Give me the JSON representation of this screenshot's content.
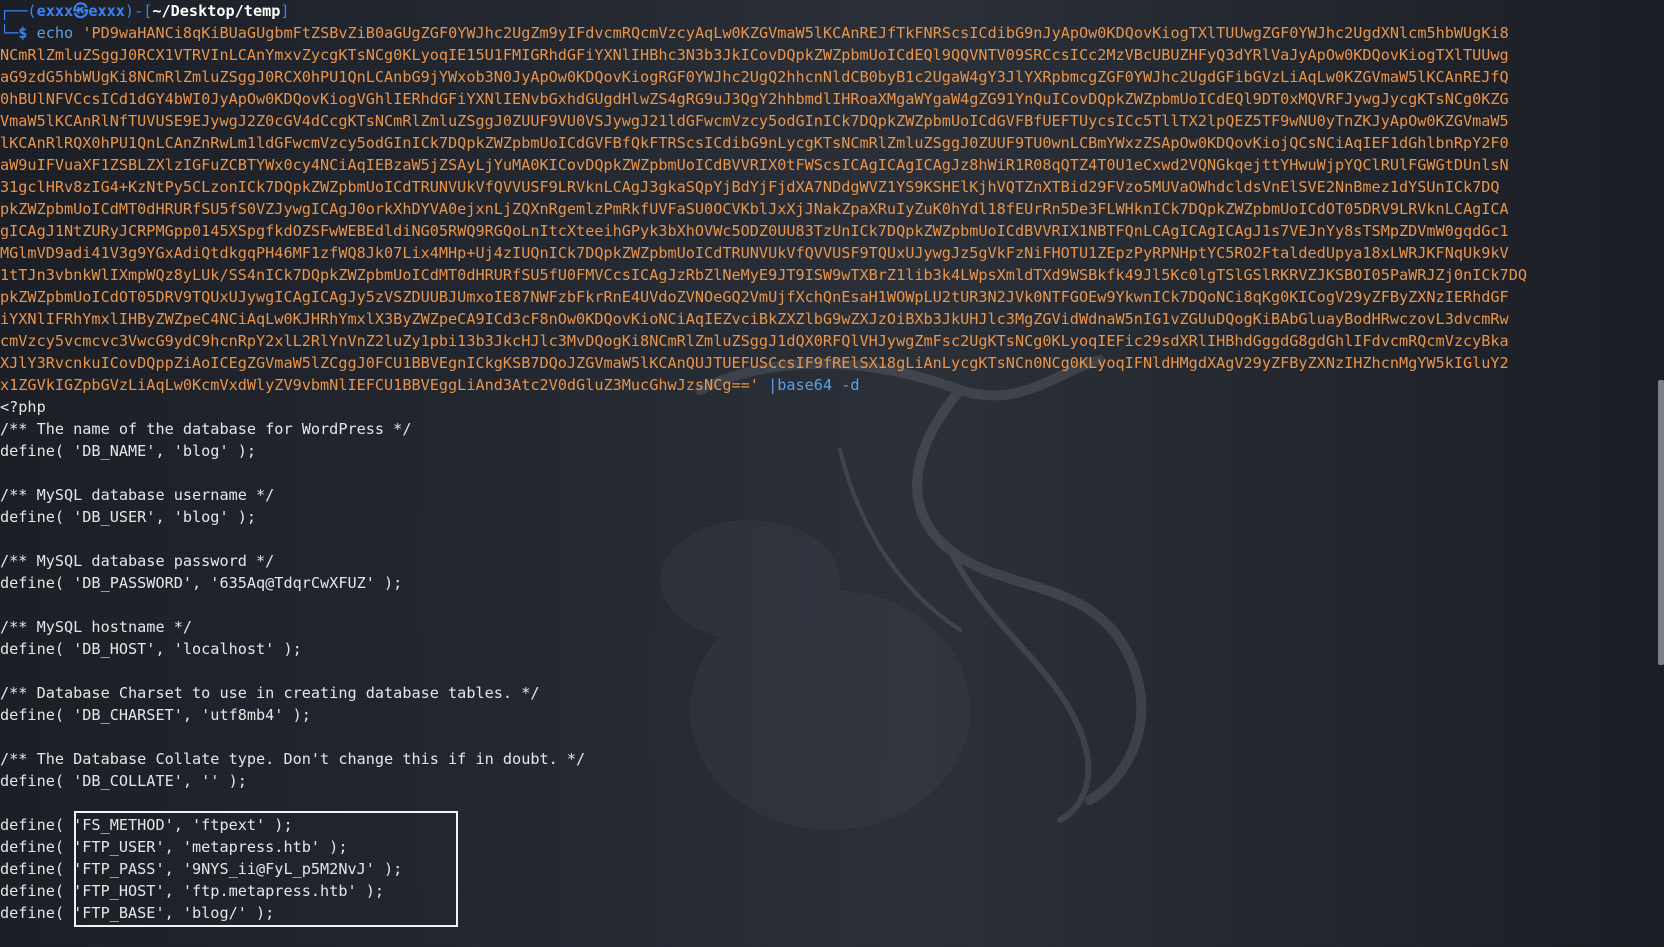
{
  "prompt": {
    "user": "exxx㉿exxx",
    "path": "~/Desktop/temp",
    "symbol": "$"
  },
  "command": {
    "name": "echo",
    "base64_lines": [
      "'PD9waHANCi8qKiBUaGUgbmFtZSBvZiB0aGUgZGF0YWJhc2UgZm9yIFdvcmRQcmVzcyAqLw0KZGVmaW5lKCAnREJfTkFNRScsICdibG9nJyApOw0KDQovKiogTXlTUUwgZGF0YWJhc2UgdXNlcm5hbWUgKi8",
      "NCmRlZmluZSggJ0RCX1VTRVInLCAnYmxvZycgKTsNCg0KLyoqIE15U1FMIGRhdGFiYXNlIHBhc3N3b3JkICovDQpkZWZpbmUoICdEQl9QQVNTV09SRCcsICc2MzVBcUBUZHFyQ3dYRlVaJyApOw0KDQovKiogTXlTUUwg",
      "aG9zdG5hbWUgKi8NCmRlZmluZSggJ0RCX0hPU1QnLCAnbG9jYWxob3N0JyApOw0KDQovKiogRGF0YWJhc2UgQ2hhcnNldCB0byB1c2UgaW4gY3JlYXRpbmcgZGF0YWJhc2UgdGFibGVzLiAqLw0KZGVmaW5lKCAnREJfQ",
      "0hBUlNFVCcsICd1dGY4bWI0JyApOw0KDQovKiogVGhlIERhdGFiYXNlIENvbGxhdGUgdHlwZS4gRG9uJ3QgY2hhbmdlIHRoaXMgaWYgaW4gZG91YnQuICovDQpkZWZpbmUoICdEQl9DT0xMQVRFJywgJycgKTsNCg0KZG",
      "VmaW5lKCAnRlNfTUVUSE9EJywgJ2Z0cGV4dCcgKTsNCmRlZmluZSggJ0ZUUF9VU0VSJywgJ21ldGFwcmVzcy5odGInICk7DQpkZWZpbmUoICdGVFBfUEFTUycsICc5TllTX2lpQEZ5TF9wNU0yTnZKJyApOw0KZGVmaW5",
      "lKCAnRlRQX0hPU1QnLCAnZnRwLm1ldGFwcmVzcy5odGInICk7DQpkZWZpbmUoICdGVFBfQkFTRScsICdibG9nLycgKTsNCmRlZmluZSggJ0ZUUF9TU0wnLCBmYWxzZSApOw0KDQovKiojQCsNCiAqIEF1dGhlbnRpY2F0",
      "aW9uIFVuaXF1ZSBLZXlzIGFuZCBTYWx0cy4NCiAqIEBzaW5jZSAyLjYuMA0KICovDQpkZWZpbmUoICdBVVRIX0tFWScsICAgICAgICAgJz8hWiR1R08qQTZ4T0U1eCxwd2VQNGkqejttYHwuWjpYQClRUlFGWGtDUnlsN",
      "31gclHRv8zIG4+KzNtPy5CLzonICk7DQpkZWZpbmUoICdTRUNVUkVfQVVUSF9LRVknLCAgJ3gkaSQpYjBdYjFjdXA7NDdgWVZ1YS9KSHElKjhVQTZnXTBid29FVzo5MUVaOWhdcldsVnElSVE2NnBmez1dYSUnICk7DQ",
      "pkZWZpbmUoICdMT0dHRURfSU5fS0VZJywgICAgJ0orkXhDYVA0ejxnLjZQXnRgemlzPmRkfUVFaSU0OCVKblJxXjJNakZpaXRuIyZuK0hYdl18fEUrRn5De3FLWHknICk7DQpkZWZpbmUoICdOT05DRV9LRVknLCAgICA",
      "gICAgJ1NtZURyJCRPMGpp0145XSpgfkdOZSFwWEBEdldiNG05RWQ9RGQoLnItcXteeihGPyk3bXhOVWc5ODZ0UU83TzUnICk7DQpkZWZpbmUoICdBVVRIX1NBTFQnLCAgICAgICAgJ1s7VEJnYy8sTSMpZDVmW0gqdGc1",
      "MGlmVD9adi41V3g9YGxAdiQtdkgqPH46MF1zfWQ8Jk07Lix4MHp+Uj4zIUQnICk7DQpkZWZpbmUoICdTRUNVUkVfQVVUSF9TQUxUJywgJz5gVkFzNiFHOTU1ZEpzPyRPNHptYC5RO2FtaldedUpya18xLWRJKFNqUk9kV",
      "1tTJn3vbnkWlIXmpWQz8yLUk/SS4nICk7DQpkZWZpbmUoICdMT0dHRURfSU5fU0FMVCcsICAgJzRbZlNeMyE9JT9ISW9wTXBrZ1lib3k4LWpsXmldTXd9WSBkfk49Jl5Kc0lgTSlGSlRKRVZJKSBOI05PaWRJZj0nICk7DQ",
      "pkZWZpbmUoICdOT05DRV9TQUxUJywgICAgICAgJy5zVSZDUUBJUmxoIE87NWFzbFkrRnE4UVdoZVNOeGQ2VmUjfXchQnEsaH1WOWpLU2tUR3N2JVk0NTFGOEw9YkwnICk7DQoNCi8qKg0KICogV29yZFByZXNzIERhdGF",
      "iYXNlIFRhYmxlIHByZWZpeC4NCiAqLw0KJHRhYmxlX3ByZWZpeCA9ICd3cF8nOw0KDQovKioNCiAqIEZvciBkZXZlbG9wZXJzOiBXb3JkUHJlc3MgZGVidWdnaW5nIG1vZGUuDQogKiBAbGluayBodHRwczovL3dvcmRw",
      "cmVzcy5vcmcvc3VwcG9ydC9hcnRpY2xlL2RlYnVnZ2luZy1pbi13b3JkcHJlc3MvDQogKi8NCmRlZmluZSggJ1dQX0RFQlVHJywgZmFsc2UgKTsNCg0KLyoqIEFic29sdXRlIHBhdGggdG8gdGhlIFdvcmRQcmVzcyBka",
      "XJlY3RvcnkuICovDQppZiAoICEgZGVmaW5lZCggJ0FCU1BBVEgnICkgKSB7DQoJZGVmaW5lKCAnQUJTUEFUSCcsIF9fRElSX18gLiAnLycgKTsNCn0NCg0KLyoqIFNldHMgdXAgV29yZFByZXNzIHZhcnMgYW5kIGluY2",
      "x1ZGVkIGZpbGVzLiAqLw0KcmVxdWlyZV9vbmNlIEFCU1BBVEggLiAnd3Atc2V0dGluZ3MucGhwJzsNCg==' |base64 -d"
    ]
  },
  "output": [
    "<?php",
    "/** The name of the database for WordPress */",
    "define( 'DB_NAME', 'blog' );",
    "",
    "/** MySQL database username */",
    "define( 'DB_USER', 'blog' );",
    "",
    "/** MySQL database password */",
    "define( 'DB_PASSWORD', '635Aq@TdqrCwXFUZ' );",
    "",
    "/** MySQL hostname */",
    "define( 'DB_HOST', 'localhost' );",
    "",
    "/** Database Charset to use in creating database tables. */",
    "define( 'DB_CHARSET', 'utf8mb4' );",
    "",
    "/** The Database Collate type. Don't change this if in doubt. */",
    "define( 'DB_COLLATE', '' );",
    "",
    "define( 'FS_METHOD', 'ftpext' );",
    "define( 'FTP_USER', 'metapress.htb' );",
    "define( 'FTP_PASS', '9NYS_ii@FyL_p5M2NvJ' );",
    "define( 'FTP_HOST', 'ftp.metapress.htb' );",
    "define( 'FTP_BASE', 'blog/' );"
  ]
}
